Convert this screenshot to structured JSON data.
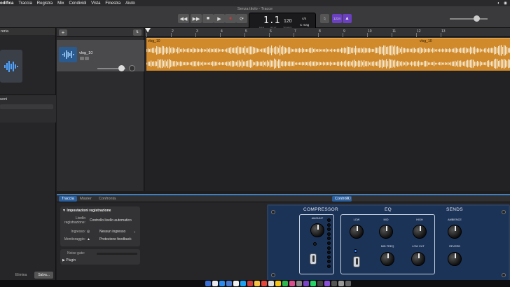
{
  "menubar": {
    "items": [
      "odifica",
      "Traccia",
      "Registra",
      "Mix",
      "Condividi",
      "Vista",
      "Finestra",
      "Aiuto"
    ]
  },
  "window": {
    "title": "Senza titolo - Tracce"
  },
  "lcd": {
    "bar_beat": "1.1",
    "bar_label": "BAR",
    "beat_label": "BEAT",
    "tempo": "120",
    "tempo_label": "TEMPO",
    "time_signature": "4/4",
    "key": "C mag"
  },
  "toolbar": {
    "count_in": "1234",
    "metronome_icon": "metronome-icon"
  },
  "library": {
    "header": "reria",
    "section_label": "uoni",
    "delete_label": "Elimina",
    "save_label": "Salva..."
  },
  "track": {
    "name": "vlog_10"
  },
  "ruler": {
    "ticks": [
      "1",
      "2",
      "3",
      "4",
      "5",
      "6",
      "7",
      "8",
      "9",
      "10",
      "11",
      "12",
      "13"
    ]
  },
  "region": {
    "name": "vlog_10",
    "name_repeat": "vlog_10"
  },
  "bottom_tabs": {
    "traccia": "Traccia",
    "master": "Master",
    "confronta": "Confronta",
    "controlli": "Controlli",
    "eq": "EQ"
  },
  "inspector": {
    "header": "Impostazioni registrazione",
    "livello_label": "Livello registrazione:",
    "livello_value": "Controllo livello automatico",
    "ingresso_label": "Ingresso:",
    "ingresso_value": "Nessun ingresso",
    "monitoraggio_label": "Monitoraggio:",
    "monitoraggio_value": "Protezione feedback",
    "noise_gate_label": "Noise gate:",
    "plugin_label": "Plugin"
  },
  "plugin": {
    "compressor": "COMPRESSOR",
    "eq": "EQ",
    "sends": "SENDS",
    "amount": "AMOUNT",
    "low": "LOW",
    "mid": "MID",
    "high": "HIGH",
    "mid_freq": "MID FREQ",
    "low_cut": "LOW CUT",
    "ambience": "AMBIENCE",
    "reverb": "REVERB"
  },
  "colors": {
    "region": "#d08a2c",
    "accent": "#2b5f9e",
    "plugin_bg": "#1c3358",
    "track_icon": "#2b5a8f"
  }
}
